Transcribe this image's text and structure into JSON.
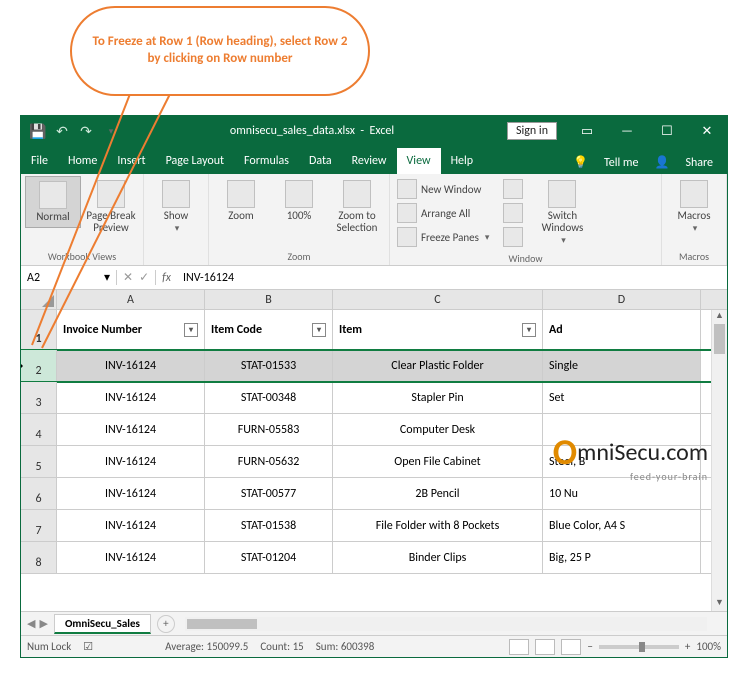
{
  "callout": {
    "text": "To Freeze at Row 1 (Row heading), select Row 2 by clicking on Row number"
  },
  "titlebar": {
    "filename": "omnisecu_sales_data.xlsx",
    "app": "Excel",
    "signin": "Sign in"
  },
  "menubar": {
    "tabs": [
      "File",
      "Home",
      "Insert",
      "Page Layout",
      "Formulas",
      "Data",
      "Review",
      "View",
      "Help"
    ],
    "active": "View",
    "tellme": "Tell me",
    "share": "Share"
  },
  "ribbon": {
    "groups": {
      "workbook_views": {
        "label": "Workbook Views",
        "normal": "Normal",
        "pagebreak": "Page Break Preview"
      },
      "show": {
        "label": "Show"
      },
      "zoom": {
        "label": "Zoom",
        "zoom": "Zoom",
        "hundred": "100%",
        "zoomsel": "Zoom to Selection"
      },
      "window": {
        "label": "Window",
        "new": "New Window",
        "arrange": "Arrange All",
        "freeze": "Freeze Panes",
        "switch": "Switch Windows"
      },
      "macros": {
        "label": "Macros",
        "macros": "Macros"
      }
    }
  },
  "formulabar": {
    "name": "A2",
    "value": "INV-16124"
  },
  "columns": [
    "A",
    "B",
    "C",
    "D"
  ],
  "header_row": {
    "num": "1",
    "cells": [
      "Invoice Number",
      "Item Code",
      "Item",
      "Ad"
    ]
  },
  "data_rows": [
    {
      "num": "2",
      "selected": true,
      "cells": [
        "INV-16124",
        "STAT-01533",
        "Clear Plastic Folder",
        "Single"
      ]
    },
    {
      "num": "3",
      "selected": false,
      "cells": [
        "INV-16124",
        "STAT-00348",
        "Stapler Pin",
        "Set"
      ]
    },
    {
      "num": "4",
      "selected": false,
      "cells": [
        "INV-16124",
        "FURN-05583",
        "Computer Desk",
        ""
      ]
    },
    {
      "num": "5",
      "selected": false,
      "cells": [
        "INV-16124",
        "FURN-05632",
        "Open File Cabinet",
        "Steel, B"
      ]
    },
    {
      "num": "6",
      "selected": false,
      "cells": [
        "INV-16124",
        "STAT-00577",
        "2B Pencil",
        "10 Nu"
      ]
    },
    {
      "num": "7",
      "selected": false,
      "cells": [
        "INV-16124",
        "STAT-01538",
        "File Folder with 8 Pockets",
        "Blue Color, A4 S"
      ]
    },
    {
      "num": "8",
      "selected": false,
      "cells": [
        "INV-16124",
        "STAT-01204",
        "Binder Clips",
        "Big, 25 P"
      ]
    }
  ],
  "sheet": {
    "name": "OmniSecu_Sales"
  },
  "statusbar": {
    "numlock": "Num Lock",
    "average_label": "Average:",
    "average": "150099.5",
    "count_label": "Count:",
    "count": "15",
    "sum_label": "Sum:",
    "sum": "600398",
    "zoom": "100%"
  },
  "watermark": {
    "prefix": "O",
    "rest": "mniSecu.com",
    "sub": "feed-your-brain"
  }
}
